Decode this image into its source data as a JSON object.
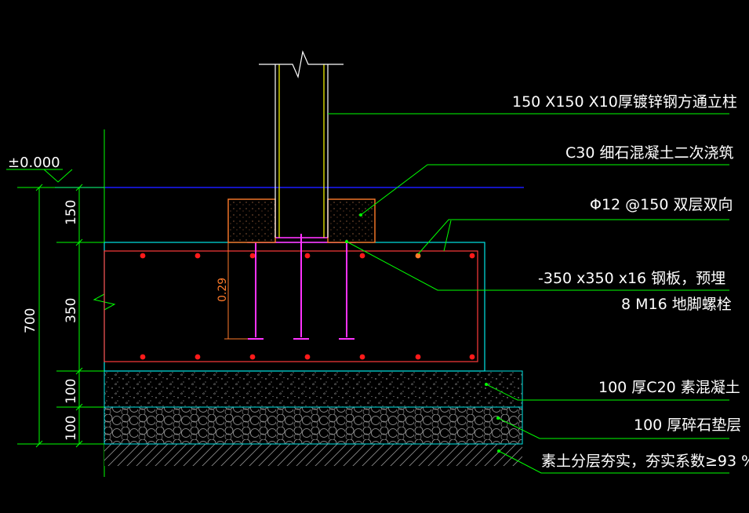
{
  "drawing": {
    "background": "#000000",
    "colors": {
      "leader": "#00ff00",
      "column": "#ffff00",
      "concrete_outline": "#ff3b3b",
      "rebar": "#ff1a1a",
      "bolt": "#ff33ff",
      "grout": "#ff7a2a",
      "slab_outline": "#00e5e5",
      "ground_line": "#1a1aff",
      "dimension": "#00ff00",
      "text": "#ffffff"
    },
    "level_mark": "±0.000",
    "dimensions": {
      "total": "700",
      "grout": "150",
      "footing": "350",
      "concrete_bed": "100",
      "gravel_bed": "100",
      "inner": "0.29"
    },
    "labels": {
      "column": "150 X150 X10厚镀锌钢方通立柱",
      "grout": "C30 细石混凝土二次浇筑",
      "rebar": "Φ12 @150 双层双向",
      "plate_line1": "-350 x350 x16 钢板，预埋",
      "plate_line2": "8 M16 地脚螺栓",
      "concrete_bed": "100 厚C20 素混凝土",
      "gravel_bed": "100 厚碎石垫层",
      "soil": "素土分层夯实，夯实系数≥93 %"
    }
  }
}
